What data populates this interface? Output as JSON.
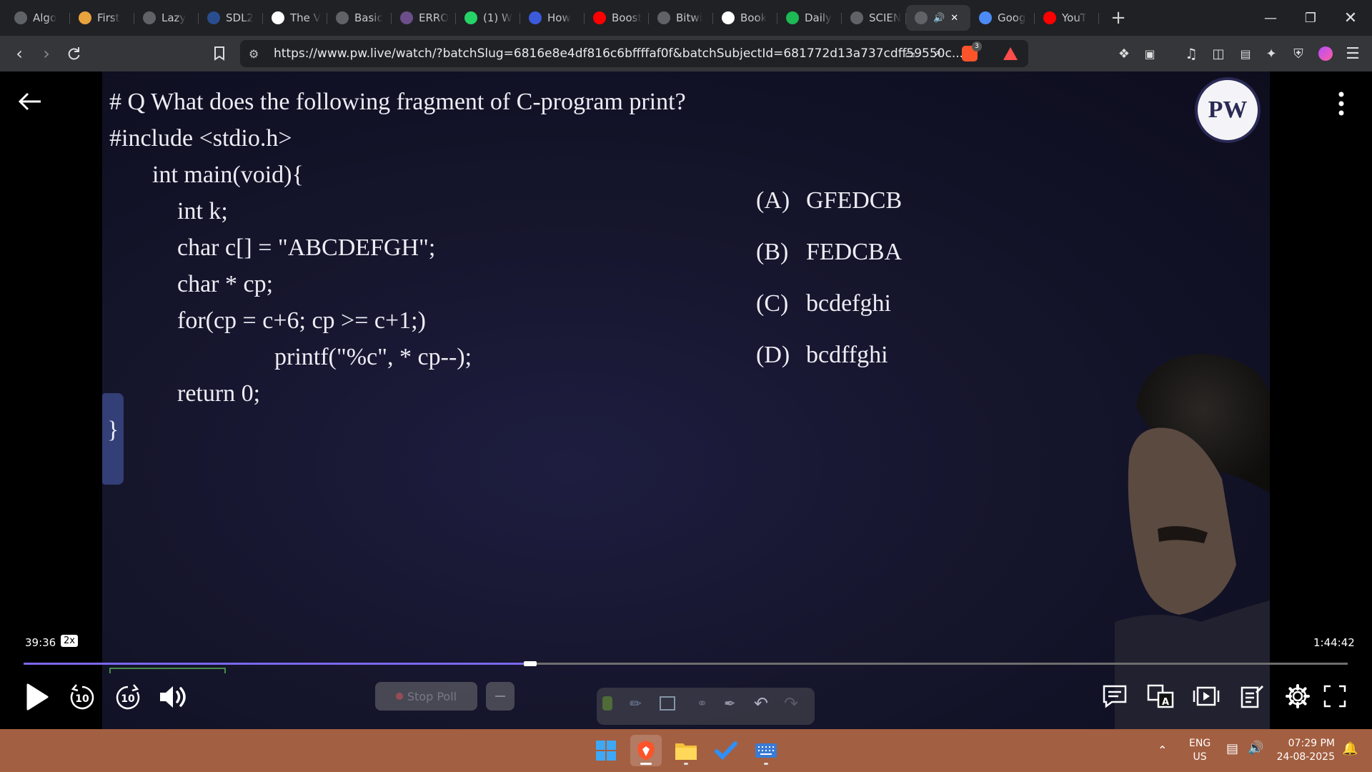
{
  "browser": {
    "tabs": [
      {
        "title": "Algo",
        "favicon": "algo-icon",
        "color": "#5f6368"
      },
      {
        "title": "First",
        "favicon": "lightning-icon",
        "color": "#e8a33d"
      },
      {
        "title": "Lazy",
        "favicon": "globe-icon",
        "color": "#5f6368"
      },
      {
        "title": "SDL2",
        "favicon": "sdl-icon",
        "color": "#2a4d8f"
      },
      {
        "title": "The V",
        "favicon": "w3-icon",
        "color": "#ffffff"
      },
      {
        "title": "Basic",
        "favicon": "page-icon",
        "color": "#5f6368"
      },
      {
        "title": "ERRO",
        "favicon": "circle-icon",
        "color": "#6b4e8a"
      },
      {
        "title": "(1) W",
        "favicon": "whatsapp-icon",
        "color": "#25d366"
      },
      {
        "title": "How",
        "favicon": "bookmark-blue-icon",
        "color": "#3b5bdb"
      },
      {
        "title": "Boost",
        "favicon": "youtube-icon",
        "color": "#ff0000"
      },
      {
        "title": "Bitwi",
        "favicon": "logo-text-icon",
        "color": "#5f6368"
      },
      {
        "title": "Book",
        "favicon": "google-icon",
        "color": "#ffffff"
      },
      {
        "title": "Daily",
        "favicon": "spotify-icon",
        "color": "#1db954"
      },
      {
        "title": "SCIEN",
        "favicon": "globe-icon",
        "color": "#5f6368"
      },
      {
        "title": "",
        "favicon": "audio-icon",
        "color": "#5f6368",
        "active": true
      },
      {
        "title": "Goog",
        "favicon": "gemini-icon",
        "color": "#4c8bf5"
      },
      {
        "title": "YouT",
        "favicon": "youtube-icon",
        "color": "#ff0000"
      }
    ],
    "url": "https://www.pw.live/watch/?batchSlug=6816e8e4df816c6bffffaf0f&batchSubjectId=681772d13a737cdff59550c...",
    "brave_badge": "3"
  },
  "lecture": {
    "question": "# Q What does the following fragment of C-program print?",
    "code": [
      "#include <stdio.h>",
      "int main(void){",
      "int k;",
      "char c[] = \"ABCDEFGH\";",
      "char * cp;",
      "for(cp = c+6; cp >= c+1;)",
      "printf(\"%c\", * cp--);",
      "return 0;",
      "}"
    ],
    "options": [
      {
        "label": "(A)",
        "text": "GFEDCB"
      },
      {
        "label": "(B)",
        "text": "FEDCBA"
      },
      {
        "label": "(C)",
        "text": "bcdefghi"
      },
      {
        "label": "(D)",
        "text": "bcdffghi"
      }
    ],
    "logo_text": "PW"
  },
  "player": {
    "current_time": "39:36",
    "total_time": "1:44:42",
    "speed": "2x",
    "progress": 0.38,
    "rewind_label": "10",
    "forward_label": "10",
    "stop_poll_label": "Stop Poll"
  },
  "taskbar": {
    "lang_line1": "ENG",
    "lang_line2": "US",
    "time": "07:29 PM",
    "date": "24-08-2025"
  }
}
